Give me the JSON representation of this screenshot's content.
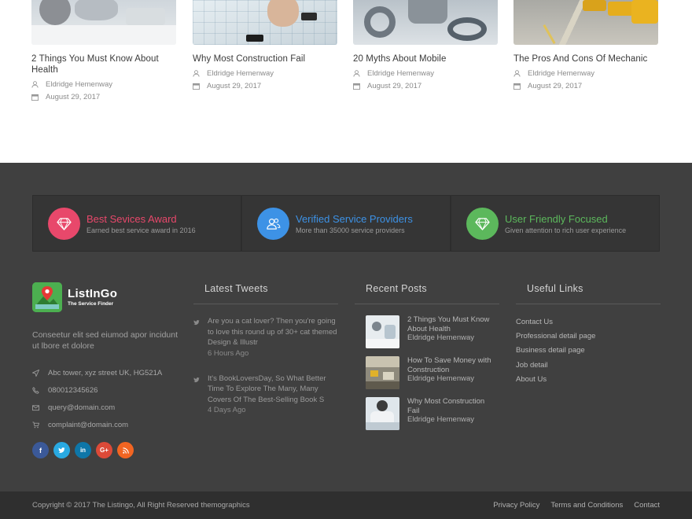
{
  "posts": [
    {
      "title": "2 Things You Must Know About Health",
      "author": "Eldridge Hemenway",
      "date": "August 29, 2017"
    },
    {
      "title": "Why Most Construction Fail",
      "author": "Eldridge Hemenway",
      "date": "August 29, 2017"
    },
    {
      "title": "20 Myths About Mobile",
      "author": "Eldridge Hemenway",
      "date": "August 29, 2017"
    },
    {
      "title": "The Pros And Cons Of Mechanic",
      "author": "Eldridge Hemenway",
      "date": "August 29, 2017"
    }
  ],
  "awards": [
    {
      "title": "Best Sevices Award",
      "subtitle": "Earned best service award in 2016",
      "color": "#e8486b",
      "icon": "diamond-icon"
    },
    {
      "title": "Verified Service Providers",
      "subtitle": "More than 35000 service providers",
      "color": "#3d92e6",
      "icon": "users-icon"
    },
    {
      "title": "User Friendly Focused",
      "subtitle": "Given attention to rich user experience",
      "color": "#5cb85c",
      "icon": "diamond-icon"
    }
  ],
  "brand": {
    "name": "ListInGo",
    "tagline": "The Service Finder",
    "about": "Conseetur elit sed eiumod apor incidunt ut lbore et dolore"
  },
  "contact": {
    "address": "Abc tower, xyz street UK, HG521A",
    "phone": "08001234562‎6",
    "email": "query@domain.com",
    "complaint": "complaint@domain.com"
  },
  "socials": [
    {
      "icon": "facebook-icon",
      "glyph": "f",
      "color": "#3b5998"
    },
    {
      "icon": "twitter-icon",
      "glyph": "t",
      "color": "#29a9e1"
    },
    {
      "icon": "linkedin-icon",
      "glyph": "in",
      "color": "#0e76a8"
    },
    {
      "icon": "google-plus-icon",
      "glyph": "G+",
      "color": "#dc4a38"
    },
    {
      "icon": "rss-icon",
      "glyph": "◔",
      "color": "#f26522"
    }
  ],
  "tweets_widget": {
    "title": "Latest Tweets",
    "tweets": [
      {
        "text": "Are you a cat lover? Then you're going to love this round up of 30+ cat themed Design & Illustr",
        "ago": "6 Hours Ago"
      },
      {
        "text": "It's BookLoversDay, So What Better Time To Explore The Many, Many Covers Of The Best-Selling Book S",
        "ago": "4 Days Ago"
      }
    ]
  },
  "recent_widget": {
    "title": "Recent Posts",
    "posts": [
      {
        "title": "2 Things You Must Know About Health",
        "author": "Eldridge Hemenway"
      },
      {
        "title": "How To Save Money with Construction",
        "author": "Eldridge Hemenway"
      },
      {
        "title": "Why Most Construction Fail",
        "author": "Eldridge Hemenway"
      }
    ]
  },
  "links_widget": {
    "title": "Useful Links",
    "links": [
      "Contact Us",
      "Professional detail page",
      "Business detail page",
      "Job detail",
      "About Us"
    ]
  },
  "bottom": {
    "copyright": "Copyright © 2017 The Listingo, All Right Reserved themographics",
    "links": [
      "Privacy Policy",
      "Terms and Conditions",
      "Contact"
    ]
  }
}
